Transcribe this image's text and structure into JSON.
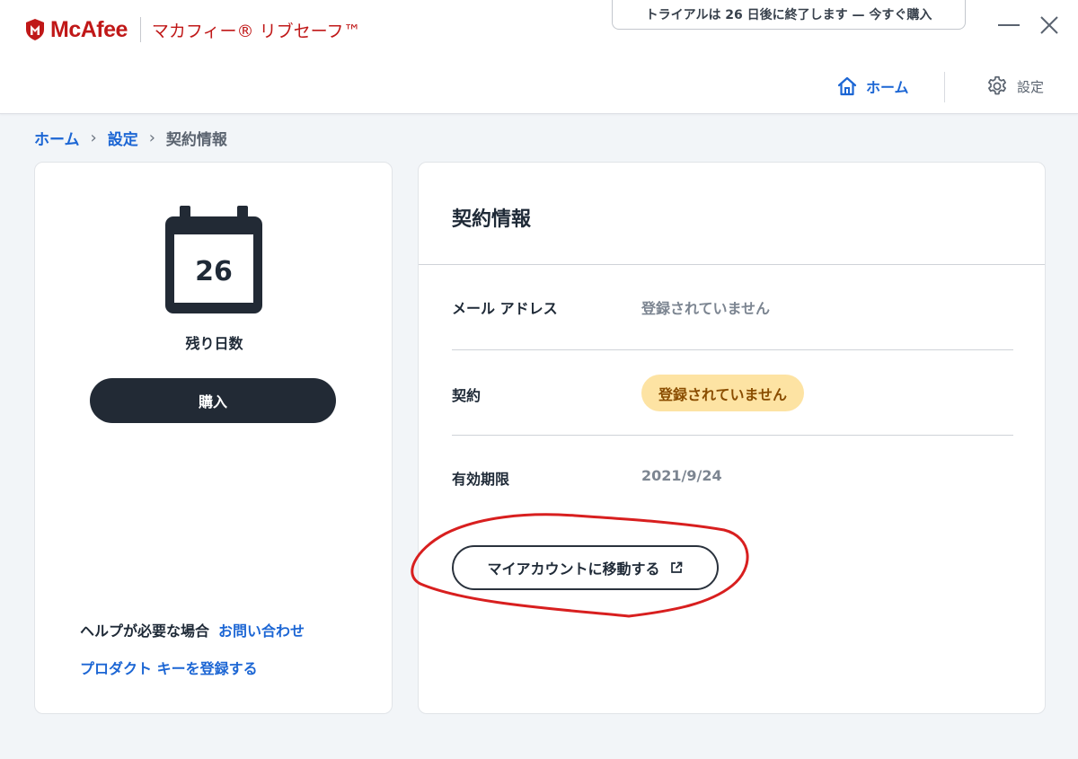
{
  "app": {
    "brand_name": "McAfee",
    "product_name": "マカフィー® リブセーフ™",
    "brand_color": "#c01818"
  },
  "trial_banner": "トライアルは 26 日後に終了します — 今すぐ購入",
  "nav": {
    "home_label": "ホーム",
    "settings_label": "設定",
    "accent_color": "#1c66d4"
  },
  "breadcrumb": {
    "items": [
      "ホーム",
      "設定",
      "契約情報"
    ]
  },
  "left_panel": {
    "days_remaining": "26",
    "days_label": "残り日数",
    "buy_label": "購入",
    "help_text": "ヘルプが必要な場合",
    "contact_link": "お問い合わせ",
    "product_key_link": "プロダクト キーを登録する"
  },
  "subscription": {
    "title": "契約情報",
    "rows": [
      {
        "label": "メール アドレス",
        "value": "登録されていません"
      },
      {
        "label": "契約",
        "value": "登録されていません"
      },
      {
        "label": "有効期限",
        "value": "2021/9/24"
      }
    ],
    "account_button": "マイアカウントに移動する",
    "badge_color": "#fde3a3"
  }
}
